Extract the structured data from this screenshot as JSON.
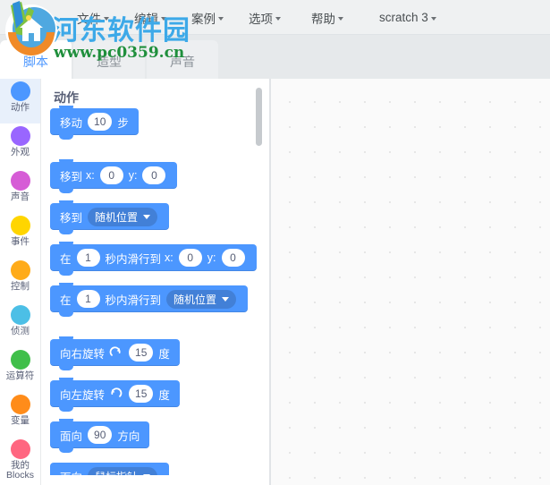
{
  "app": {
    "title": "scratch 3",
    "watermark_main": "河东软件园",
    "watermark_url": "www.pc0359.cn",
    "logo_name": "hedong-software-park-logo"
  },
  "menu": {
    "items": [
      {
        "label": "文件",
        "has_caret": true
      },
      {
        "label": "编辑",
        "has_caret": true
      },
      {
        "label": "案例",
        "has_caret": true
      },
      {
        "label": "选项",
        "has_caret": true
      },
      {
        "label": "帮助",
        "has_caret": true
      },
      {
        "label": "scratch 3",
        "has_caret": true
      }
    ]
  },
  "tabs": [
    {
      "label": "脚本",
      "active": true
    },
    {
      "label": "造型",
      "active": false
    },
    {
      "label": "声音",
      "active": false
    }
  ],
  "categories": [
    {
      "label": "动作",
      "color": "#4c97ff",
      "selected": true
    },
    {
      "label": "外观",
      "color": "#9966ff",
      "selected": false
    },
    {
      "label": "声音",
      "color": "#d65cd6",
      "selected": false
    },
    {
      "label": "事件",
      "color": "#ffd500",
      "selected": false
    },
    {
      "label": "控制",
      "color": "#ffab19",
      "selected": false
    },
    {
      "label": "侦测",
      "color": "#4cbfe6",
      "selected": false
    },
    {
      "label": "运算符",
      "color": "#40bf4a",
      "selected": false
    },
    {
      "label": "变量",
      "color": "#ff8c1a",
      "selected": false
    },
    {
      "label": "我的 Blocks",
      "color": "#ff6680",
      "selected": false
    }
  ],
  "palette": {
    "title": "动作",
    "accent_color": "#4c97ff",
    "dropdown_color": "#4280d7",
    "scrollbar": {
      "thumb_color": "#c6cace"
    },
    "blocks": [
      {
        "id": "motion-move-steps",
        "parts": [
          {
            "type": "text",
            "value": "移动"
          },
          {
            "type": "input",
            "value": "10"
          },
          {
            "type": "text",
            "value": "步"
          }
        ]
      },
      {
        "id": "motion-goto-xy",
        "gap_before": true,
        "parts": [
          {
            "type": "text",
            "value": "移到"
          },
          {
            "type": "text",
            "value": "x:"
          },
          {
            "type": "input",
            "value": "0"
          },
          {
            "type": "text",
            "value": "y:"
          },
          {
            "type": "input",
            "value": "0"
          }
        ]
      },
      {
        "id": "motion-goto-target",
        "parts": [
          {
            "type": "text",
            "value": "移到"
          },
          {
            "type": "dropdown",
            "value": "随机位置"
          }
        ]
      },
      {
        "id": "motion-glide-secs-xy",
        "parts": [
          {
            "type": "text",
            "value": "在"
          },
          {
            "type": "input",
            "value": "1"
          },
          {
            "type": "text",
            "value": "秒内滑行到"
          },
          {
            "type": "text",
            "value": "x:"
          },
          {
            "type": "input",
            "value": "0"
          },
          {
            "type": "text",
            "value": "y:"
          },
          {
            "type": "input",
            "value": "0"
          }
        ]
      },
      {
        "id": "motion-glide-secs-target",
        "parts": [
          {
            "type": "text",
            "value": "在"
          },
          {
            "type": "input",
            "value": "1"
          },
          {
            "type": "text",
            "value": "秒内滑行到"
          },
          {
            "type": "dropdown",
            "value": "随机位置"
          }
        ]
      },
      {
        "id": "motion-turn-right",
        "gap_before": true,
        "parts": [
          {
            "type": "text",
            "value": "向右旋转"
          },
          {
            "type": "icon",
            "value": "turn-right-icon"
          },
          {
            "type": "input",
            "value": "15"
          },
          {
            "type": "text",
            "value": "度"
          }
        ]
      },
      {
        "id": "motion-turn-left",
        "parts": [
          {
            "type": "text",
            "value": "向左旋转"
          },
          {
            "type": "icon",
            "value": "turn-left-icon"
          },
          {
            "type": "input",
            "value": "15"
          },
          {
            "type": "text",
            "value": "度"
          }
        ]
      },
      {
        "id": "motion-point-direction",
        "parts": [
          {
            "type": "text",
            "value": "面向"
          },
          {
            "type": "input",
            "value": "90"
          },
          {
            "type": "text",
            "value": "方向"
          }
        ]
      },
      {
        "id": "motion-point-towards",
        "clipped": true,
        "parts": [
          {
            "type": "text",
            "value": "面向"
          },
          {
            "type": "dropdown",
            "value": "鼠标指针"
          }
        ]
      }
    ]
  },
  "canvas": {
    "name": "script-workspace",
    "background": "#fafafa",
    "dot_color": "#e6e6e6"
  }
}
